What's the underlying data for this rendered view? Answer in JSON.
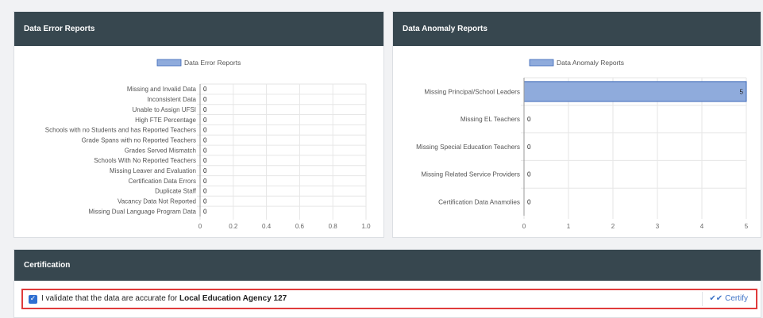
{
  "error_panel": {
    "title": "Data Error Reports"
  },
  "anomaly_panel": {
    "title": "Data Anomaly Reports"
  },
  "certification": {
    "title": "Certification",
    "checkbox_checked": true,
    "validate_text": "I validate that the data are accurate for",
    "agency_name": "Local Education Agency 127",
    "certify_label": "Certify",
    "certify_icon": "double-check-icon"
  },
  "colors": {
    "header_bg": "#37474f",
    "bar_fill": "#8fabdc",
    "bar_stroke": "#3c68b8",
    "certify_accent": "#3f73c6",
    "highlight_border": "#e03b3b"
  },
  "chart_data": [
    {
      "type": "bar",
      "orientation": "horizontal",
      "legend": "Data Error Reports",
      "legend_position": "top",
      "categories": [
        "Missing and Invalid Data",
        "Inconsistent Data",
        "Unable to Assign UFSI",
        "High FTE Percentage",
        "Schools with no Students and has Reported Teachers",
        "Grade Spans with no Reported Teachers",
        "Grades Served Mismatch",
        "Schools With No Reported Teachers",
        "Missing Leaver and Evaluation",
        "Certification Data Errors",
        "Duplicate Staff",
        "Vacancy Data Not Reported",
        "Missing Dual Language Program Data"
      ],
      "series": [
        {
          "name": "Data Error Reports",
          "values": [
            0,
            0,
            0,
            0,
            0,
            0,
            0,
            0,
            0,
            0,
            0,
            0,
            0
          ]
        }
      ],
      "xlim": [
        0,
        1.0
      ],
      "xticks": [
        "0",
        "0.2",
        "0.4",
        "0.6",
        "0.8",
        "1.0"
      ],
      "grid": true
    },
    {
      "type": "bar",
      "orientation": "horizontal",
      "legend": "Data Anomaly Reports",
      "legend_position": "top",
      "categories": [
        "Missing Principal/School Leaders",
        "Missing EL Teachers",
        "Missing Special Education Teachers",
        "Missing Related Service Providers",
        "Certification Data Anamolies"
      ],
      "series": [
        {
          "name": "Data Anomaly Reports",
          "values": [
            5,
            0,
            0,
            0,
            0
          ]
        }
      ],
      "xlim": [
        0,
        5
      ],
      "xticks": [
        "0",
        "1",
        "2",
        "3",
        "4",
        "5"
      ],
      "grid": true
    }
  ]
}
